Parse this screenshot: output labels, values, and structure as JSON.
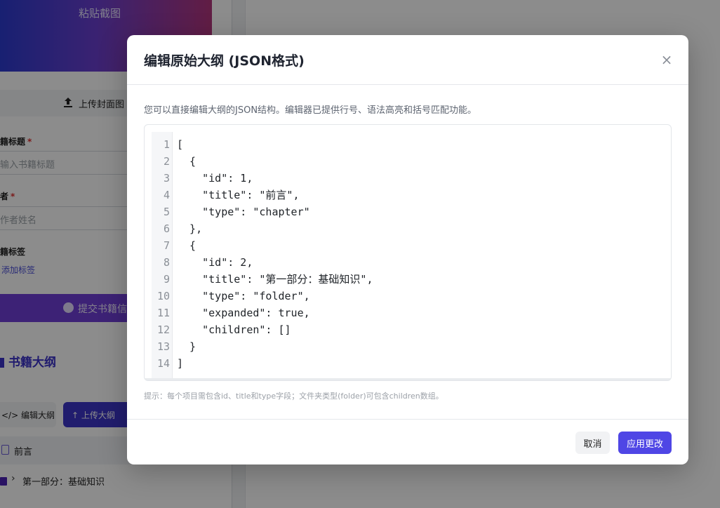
{
  "background": {
    "cover_banner_text": "粘贴截图",
    "upload_cover_label": "上传封面图",
    "title_field": {
      "label": "籍标题",
      "required_mark": "*",
      "placeholder": "输入书籍标题"
    },
    "author_field": {
      "label": "者",
      "required_mark": "*",
      "placeholder": "作者姓名"
    },
    "tags_field": {
      "label": "籍标签",
      "add_tag_label": "添加标签"
    },
    "submit_label": "提交书籍信",
    "outline_title": "书籍大纲",
    "edit_outline_label": "</>  编辑大纲",
    "upload_outline_label": "上传大纲",
    "tree": [
      {
        "label": "前言",
        "icon": "file-icon"
      },
      {
        "label": "第一部分：基础知识",
        "icon": "folder-icon"
      }
    ]
  },
  "modal": {
    "title": "编辑原始大纲 (JSON格式)",
    "close_glyph": "×",
    "description": "您可以直接编辑大纲的JSON结构。编辑器已提供行号、语法高亮和括号匹配功能。",
    "code_lines": [
      {
        "ln": "1",
        "text": "["
      },
      {
        "ln": "2",
        "text": "  {"
      },
      {
        "ln": "3",
        "text": "    \"id\": 1,"
      },
      {
        "ln": "4",
        "text": "    \"title\": \"前言\","
      },
      {
        "ln": "5",
        "text": "    \"type\": \"chapter\""
      },
      {
        "ln": "6",
        "text": "  },"
      },
      {
        "ln": "7",
        "text": "  {"
      },
      {
        "ln": "8",
        "text": "    \"id\": 2,"
      },
      {
        "ln": "9",
        "text": "    \"title\": \"第一部分：基础知识\","
      },
      {
        "ln": "10",
        "text": "    \"type\": \"folder\","
      },
      {
        "ln": "11",
        "text": "    \"expanded\": true,"
      },
      {
        "ln": "12",
        "text": "    \"children\": []"
      },
      {
        "ln": "13",
        "text": "  }"
      },
      {
        "ln": "14",
        "text": "]"
      }
    ],
    "hint": "提示：每个项目需包含id、title和type字段；文件夹类型(folder)可包含children数组。",
    "cancel_label": "取消",
    "apply_label": "应用更改"
  },
  "colors": {
    "accent": "#4f46e5",
    "overlay": "rgba(0,0,0,0.45)"
  }
}
